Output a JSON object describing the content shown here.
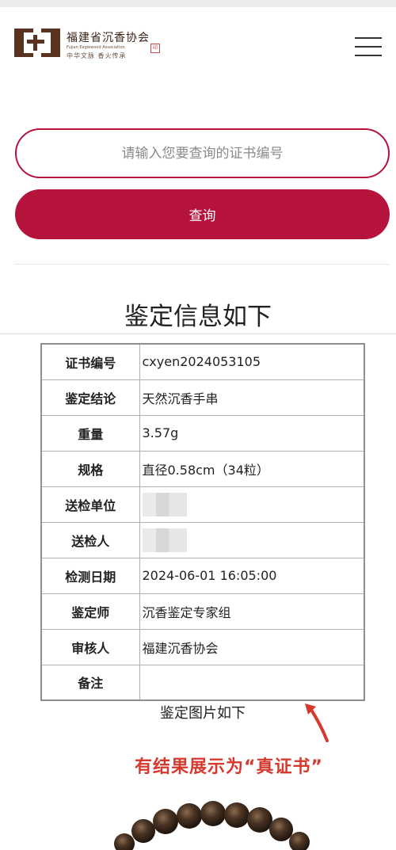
{
  "header": {
    "org_name": "福建省沉香协会",
    "org_name_en": "Fujian Eaglewood Association",
    "slogan": "中华文脉 香火传承",
    "seal": "印"
  },
  "search": {
    "placeholder": "请输入您要查询的证书编号",
    "value": "",
    "button_label": "查询"
  },
  "result": {
    "title": "鉴定信息如下",
    "rows": [
      {
        "label": "证书编号",
        "value": "cxyen2024053105"
      },
      {
        "label": "鉴定结论",
        "value": "天然沉香手串"
      },
      {
        "label": "重量",
        "value": "3.57g"
      },
      {
        "label": "规格",
        "value": "直径0.58cm（34粒）"
      },
      {
        "label": "送检单位",
        "value": ""
      },
      {
        "label": "送检人",
        "value": ""
      },
      {
        "label": "检测日期",
        "value": "2024-06-01 16:05:00"
      },
      {
        "label": "鉴定师",
        "value": "沉香鉴定专家组"
      },
      {
        "label": "审核人",
        "value": "福建沉香协会"
      },
      {
        "label": "备注",
        "value": ""
      }
    ],
    "photo_title": "鉴定图片如下"
  },
  "annotation": {
    "text": "有结果展示为“真证书”",
    "color": "#d63a2f"
  },
  "colors": {
    "accent": "#b5123c",
    "brand_brown": "#5a3220"
  }
}
